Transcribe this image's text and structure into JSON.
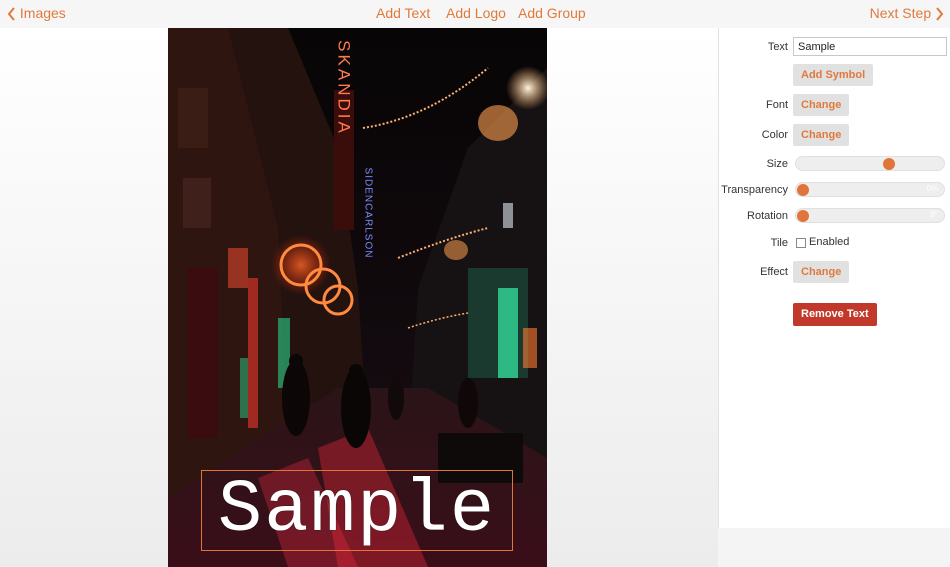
{
  "nav": {
    "back_label": "Images",
    "add_text": "Add Text",
    "add_logo": "Add Logo",
    "add_group": "Add Group",
    "next_label": "Next Step"
  },
  "canvas": {
    "overlay_text": "Sample",
    "sign_vertical": "SKANDIA",
    "sign_blue": "SIDENCARLSON"
  },
  "panel": {
    "text_label": "Text",
    "text_value": "Sample",
    "add_symbol": "Add Symbol",
    "font_label": "Font",
    "color_label": "Color",
    "change_label": "Change",
    "size_label": "Size",
    "size_value": 0.63,
    "transparency_label": "Transparency",
    "transparency_value": "0%",
    "rotation_label": "Rotation",
    "rotation_value": "0°",
    "tile_label": "Tile",
    "tile_enabled_label": "Enabled",
    "tile_checked": false,
    "effect_label": "Effect",
    "remove_text": "Remove Text"
  },
  "colors": {
    "accent": "#e07a3c",
    "danger": "#c0392b"
  }
}
